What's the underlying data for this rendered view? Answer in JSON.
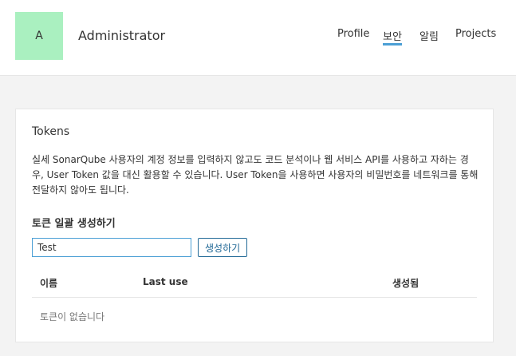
{
  "header": {
    "avatar_initial": "A",
    "user_name": "Administrator",
    "nav": [
      {
        "label": "Profile",
        "active": false
      },
      {
        "label": "보안",
        "active": true
      },
      {
        "label": "알림",
        "active": false
      },
      {
        "label": "Projects",
        "active": false
      }
    ]
  },
  "tokens_card": {
    "title": "Tokens",
    "description": "실세 SonarQube 사용자의 계정 정보를 입력하지 않고도 코드 분석이나 웹 서비스 API를 사용하고 자하는 경우, User Token 값을 대신 활용할 수 있습니다. User Token을 사용하면 사용자의 비밀번호를 네트워크를 통해 전달하지 않아도 됩니다.",
    "generate_section_title": "토큰 일괄 생성하기",
    "token_input_value": "Test",
    "generate_button": "생성하기",
    "table": {
      "columns": [
        "이름",
        "Last use",
        "생성됨"
      ],
      "empty_message": "토큰이 없습니다"
    }
  },
  "colors": {
    "accent": "#4b9fd5",
    "avatar_bg": "#aaf0c0",
    "button": "#236a97"
  }
}
